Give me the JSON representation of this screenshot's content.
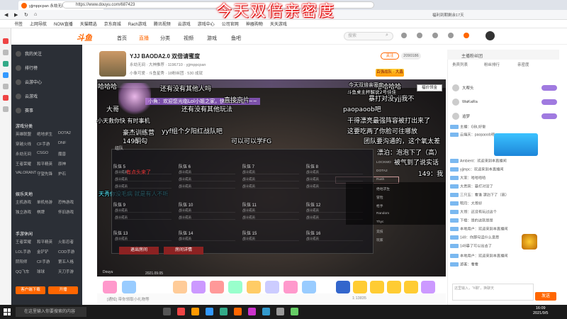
{
  "overlay_title": "今天双倍亲密度",
  "browser": {
    "tab_title": "yjjmppcpan 永劫无间直播",
    "url": "https://www.douyu.com/687423",
    "address_hint": "虎牙直播",
    "right_label": "福利到期剩余17天",
    "bookmarks": [
      "书签",
      "上网导航",
      "NOW直播",
      "天猫精选",
      "京东商城",
      "Rach游戏",
      "腾讯视频",
      "云游戏",
      "游戏中心",
      "公司官网",
      "神器购物",
      "天天游戏"
    ]
  },
  "site": {
    "logo": "斗鱼",
    "nav": [
      "首页",
      "直播",
      "分类",
      "视频",
      "游戏",
      "鱼吧"
    ],
    "search_placeholder": "搜索"
  },
  "sidebar": {
    "items": [
      "我的关注",
      "排行榜",
      "云游中心",
      "云游戏",
      "赛事"
    ],
    "game_head": "游戏分类",
    "games": [
      "英雄联盟",
      "绝地求生",
      "DOTA2",
      "穿越火线",
      "CF手游",
      "DNF",
      "永劫无间",
      "CSGO",
      "魔兽",
      "王者荣耀",
      "和平精英",
      "原神",
      "VALORANT",
      "守望先锋",
      "炉石"
    ],
    "mobile_head": "娱乐天地",
    "mobile": [
      "主机游戏",
      "单机热游",
      "恐怖游戏",
      "独立游戏",
      "棋牌",
      "怀旧游戏"
    ],
    "app_head": "手游休闲",
    "apps": [
      "王者荣耀",
      "和平精英",
      "火影忍者",
      "LOL手游",
      "金铲铲",
      "COD手游",
      "阴阳师",
      "CF手游",
      "第五人格",
      "QQ飞车",
      "球球",
      "天刀手游"
    ],
    "btn_download": "客户端下载",
    "btn_open": "开播"
  },
  "room": {
    "title": "YJJ BAODA2.0 双倍请蜜度",
    "meta": "永劫无间 · 大神推荐 · 1196710 · yjjmppcpan",
    "meta2": "小象可爱 · 斗鱼星秀 · 18粉丝团 · 530 成就",
    "follow": "关注",
    "fans": "2090186",
    "rank": "百强战队 · 大鑫",
    "task": "福价领金"
  },
  "video": {
    "danmaku": [
      "哈哈哈",
      "哈哈哈哈",
      "还有没有其他玩法",
      "直接京片",
      "paopaoob吧",
      "大哥",
      "还有没有其他人吗",
      "豪杰训练营",
      "yyf组个夕阳红战队吧",
      "149酮勾",
      "可以可以学FG",
      "干得漂亮最强阵容被打出来了",
      "这要吃两了你脸可往哪放",
      "团队要沟通的，这个氧太差",
      "小天救你快 有时事机",
      "天秀你没毛病 就是有人不听",
      "今天双倍亲密度",
      "斗鱼桌主杯解说2号佳佳",
      "暴打对没yjj我不",
      "漂泊：泡泡下了（高）",
      "被气到了说实话",
      "149：我"
    ],
    "header_text": "小魚：欢迎您光临Lol小姐之家，快来围观吧~~~",
    "panel_title": "组队",
    "team_labels": [
      "队伍 5",
      "队伍 6",
      "队伍 7",
      "队伍 8",
      "队伍 9",
      "队伍 10",
      "队伍 11",
      "队伍 12",
      "队伍 13",
      "队伍 14",
      "队伍 15",
      "队伍 16"
    ],
    "slot_text": "战斗成员",
    "red_label": "有点头来了",
    "btn_exit": "退出房间",
    "btn_details": "房间详情",
    "right_list": [
      "LOCKMO",
      "DOTA2",
      "Rush",
      "绝地求生",
      "冒险",
      "枪手",
      "Random",
      "Thyc",
      "竞技",
      "玩家"
    ],
    "timestamp": "2021.09.05",
    "watermark": "Douyu"
  },
  "bottom": {
    "chat_hint": "[通知] 带你领取小礼物等",
    "counter": "1:13835"
  },
  "right_panel": {
    "header": "主播粉丝团",
    "tabs": [
      "贵宾列表",
      "粉丝排行",
      "亲密度"
    ],
    "ranks": [
      {
        "name": "大帮头",
        "color": "#f3c"
      },
      {
        "name": "WaKaRa",
        "color": "#9c6"
      },
      {
        "name": "追梦",
        "color": "#69c"
      }
    ],
    "chat": [
      "主播：GBL好俊",
      "云端天：paopaoob吧",
      "Ambient：欢迎来到本直播间",
      "yjjmpc：欢迎来到本直播间",
      "大家：哈哈哈哈",
      "大贵宾：暴打对没了",
      "三只五：看谁 漂泊下了（高）",
      "明月：大哥好",
      "大哥：还没有玩过这个",
      "下楼：是的这就是是",
      "本地用户：欢迎来到本直播间",
      "149：你那句话什么意思",
      "149暴了可以出去了",
      "本地用户：欢迎来到本直播间",
      "游客：看看"
    ],
    "chat_placeholder": "这里输入，“#聊”，换聊天",
    "send": "发送"
  },
  "taskbar": {
    "search": "在这里输入你要搜索的内容",
    "time": "16:09",
    "date": "2021/9/5"
  }
}
